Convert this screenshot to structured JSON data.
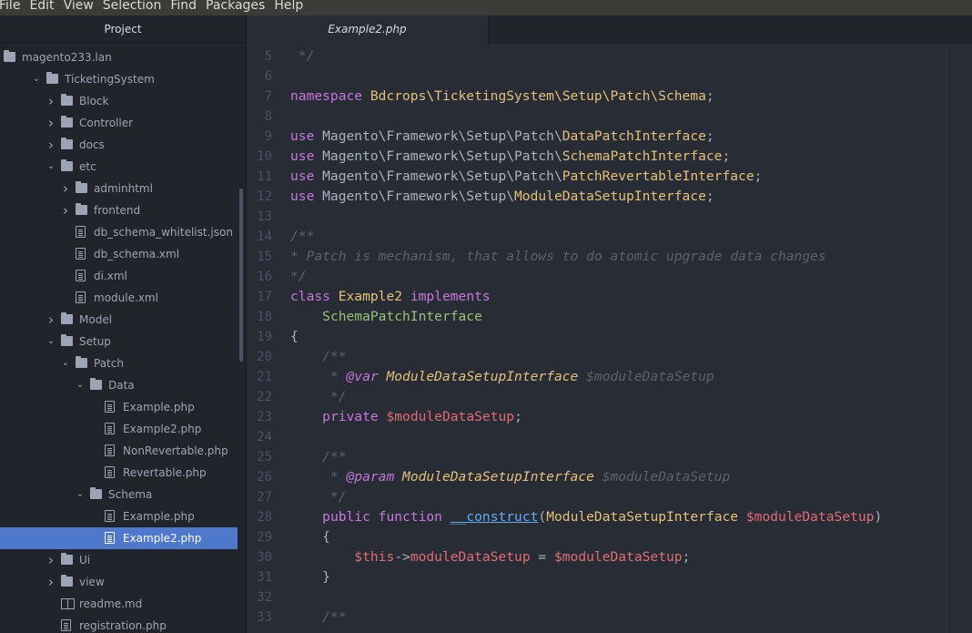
{
  "menu": [
    "File",
    "Edit",
    "View",
    "Selection",
    "Find",
    "Packages",
    "Help"
  ],
  "sidebar": {
    "title": "Project",
    "tree": [
      {
        "label": "magento233.lan",
        "type": "folder",
        "depth": 0,
        "chevron": ""
      },
      {
        "label": "TicketingSystem",
        "type": "folder",
        "depth": 3,
        "chevron": "⌄"
      },
      {
        "label": "Block",
        "type": "folder",
        "depth": 4,
        "chevron": "›"
      },
      {
        "label": "Controller",
        "type": "folder",
        "depth": 4,
        "chevron": "›"
      },
      {
        "label": "docs",
        "type": "folder",
        "depth": 4,
        "chevron": "›"
      },
      {
        "label": "etc",
        "type": "folder",
        "depth": 4,
        "chevron": "⌄"
      },
      {
        "label": "adminhtml",
        "type": "folder",
        "depth": 5,
        "chevron": "›"
      },
      {
        "label": "frontend",
        "type": "folder",
        "depth": 5,
        "chevron": "›"
      },
      {
        "label": "db_schema_whitelist.json",
        "type": "file",
        "depth": 5,
        "chevron": ""
      },
      {
        "label": "db_schema.xml",
        "type": "file",
        "depth": 5,
        "chevron": ""
      },
      {
        "label": "di.xml",
        "type": "file",
        "depth": 5,
        "chevron": ""
      },
      {
        "label": "module.xml",
        "type": "file",
        "depth": 5,
        "chevron": ""
      },
      {
        "label": "Model",
        "type": "folder",
        "depth": 4,
        "chevron": "›"
      },
      {
        "label": "Setup",
        "type": "folder",
        "depth": 4,
        "chevron": "⌄"
      },
      {
        "label": "Patch",
        "type": "folder",
        "depth": 5,
        "chevron": "⌄"
      },
      {
        "label": "Data",
        "type": "folder",
        "depth": 6,
        "chevron": "⌄"
      },
      {
        "label": "Example.php",
        "type": "file",
        "depth": 7,
        "chevron": ""
      },
      {
        "label": "Example2.php",
        "type": "file",
        "depth": 7,
        "chevron": ""
      },
      {
        "label": "NonRevertable.php",
        "type": "file",
        "depth": 7,
        "chevron": ""
      },
      {
        "label": "Revertable.php",
        "type": "file",
        "depth": 7,
        "chevron": ""
      },
      {
        "label": "Schema",
        "type": "folder",
        "depth": 6,
        "chevron": "⌄"
      },
      {
        "label": "Example.php",
        "type": "file",
        "depth": 7,
        "chevron": ""
      },
      {
        "label": "Example2.php",
        "type": "file",
        "depth": 7,
        "chevron": "",
        "selected": true
      },
      {
        "label": "Ui",
        "type": "folder",
        "depth": 4,
        "chevron": "›"
      },
      {
        "label": "view",
        "type": "folder",
        "depth": 4,
        "chevron": "›"
      },
      {
        "label": "readme.md",
        "type": "book",
        "depth": 4,
        "chevron": ""
      },
      {
        "label": "registration.php",
        "type": "file",
        "depth": 4,
        "chevron": ""
      }
    ]
  },
  "tabs": [
    {
      "label": "Example2.php",
      "active": true
    }
  ],
  "editor": {
    "lines": [
      {
        "n": "5",
        "tokens": [
          [
            " */",
            "cm"
          ]
        ]
      },
      {
        "n": "6",
        "tokens": []
      },
      {
        "n": "7",
        "tokens": [
          [
            "namespace",
            "kw"
          ],
          [
            " ",
            "pl"
          ],
          [
            "Bdcrops\\TicketingSystem\\Setup\\Patch\\Schema",
            "tp"
          ],
          [
            ";",
            "pl"
          ]
        ]
      },
      {
        "n": "8",
        "tokens": []
      },
      {
        "n": "9",
        "tokens": [
          [
            "use",
            "kw"
          ],
          [
            " Magento\\Framework\\Setup\\Patch\\",
            "pl"
          ],
          [
            "DataPatchInterface",
            "tp"
          ],
          [
            ";",
            "pl"
          ]
        ]
      },
      {
        "n": "10",
        "tokens": [
          [
            "use",
            "kw"
          ],
          [
            " Magento\\Framework\\Setup\\Patch\\",
            "pl"
          ],
          [
            "SchemaPatchInterface",
            "tp"
          ],
          [
            ";",
            "pl"
          ]
        ]
      },
      {
        "n": "11",
        "tokens": [
          [
            "use",
            "kw"
          ],
          [
            " Magento\\Framework\\Setup\\Patch\\",
            "pl"
          ],
          [
            "PatchRevertableInterface",
            "tp"
          ],
          [
            ";",
            "pl"
          ]
        ]
      },
      {
        "n": "12",
        "tokens": [
          [
            "use",
            "kw"
          ],
          [
            " Magento\\Framework\\Setup\\",
            "pl"
          ],
          [
            "ModuleDataSetupInterface",
            "tp"
          ],
          [
            ";",
            "pl"
          ]
        ]
      },
      {
        "n": "13",
        "tokens": []
      },
      {
        "n": "14",
        "tokens": [
          [
            "/**",
            "cm"
          ]
        ]
      },
      {
        "n": "15",
        "tokens": [
          [
            "* Patch is mechanism, that allows to do atomic upgrade data changes",
            "cm"
          ]
        ]
      },
      {
        "n": "16",
        "tokens": [
          [
            "*/",
            "cm"
          ]
        ]
      },
      {
        "n": "17",
        "tokens": [
          [
            "class",
            "kw"
          ],
          [
            " ",
            "pl"
          ],
          [
            "Example2",
            "tp"
          ],
          [
            " ",
            "pl"
          ],
          [
            "implements",
            "kw"
          ]
        ]
      },
      {
        "n": "18",
        "tokens": [
          [
            "    ",
            "pl"
          ],
          [
            "SchemaPatchInterface",
            "gn"
          ]
        ]
      },
      {
        "n": "19",
        "tokens": [
          [
            "{",
            "pl"
          ]
        ]
      },
      {
        "n": "20",
        "tokens": [
          [
            "    /**",
            "cm"
          ]
        ]
      },
      {
        "n": "21",
        "tokens": [
          [
            "     * ",
            "cm"
          ],
          [
            "@var",
            "dc"
          ],
          [
            " ",
            "cm"
          ],
          [
            "ModuleDataSetupInterface",
            "ct"
          ],
          [
            " $moduleDataSetup",
            "cm"
          ]
        ]
      },
      {
        "n": "22",
        "tokens": [
          [
            "     */",
            "cm"
          ]
        ]
      },
      {
        "n": "23",
        "tokens": [
          [
            "    ",
            "pl"
          ],
          [
            "private",
            "kw"
          ],
          [
            " ",
            "pl"
          ],
          [
            "$moduleDataSetup",
            "vr"
          ],
          [
            ";",
            "pl"
          ]
        ]
      },
      {
        "n": "24",
        "tokens": []
      },
      {
        "n": "25",
        "tokens": [
          [
            "    /**",
            "cm"
          ]
        ]
      },
      {
        "n": "26",
        "tokens": [
          [
            "     * ",
            "cm"
          ],
          [
            "@param",
            "dc"
          ],
          [
            " ",
            "cm"
          ],
          [
            "ModuleDataSetupInterface",
            "ct"
          ],
          [
            " $moduleDataSetup",
            "cm"
          ]
        ]
      },
      {
        "n": "27",
        "tokens": [
          [
            "     */",
            "cm"
          ]
        ]
      },
      {
        "n": "28",
        "tokens": [
          [
            "    ",
            "pl"
          ],
          [
            "public",
            "kw"
          ],
          [
            " ",
            "pl"
          ],
          [
            "function",
            "kw"
          ],
          [
            " ",
            "pl"
          ],
          [
            "__construct",
            "fn"
          ],
          [
            "(",
            "pl"
          ],
          [
            "ModuleDataSetupInterface",
            "tp"
          ],
          [
            " ",
            "pl"
          ],
          [
            "$moduleDataSetup",
            "vr"
          ],
          [
            ")",
            "pl"
          ]
        ]
      },
      {
        "n": "29",
        "tokens": [
          [
            "    {",
            "pl"
          ]
        ]
      },
      {
        "n": "30",
        "tokens": [
          [
            "        ",
            "pl"
          ],
          [
            "$this",
            "vr"
          ],
          [
            "->",
            "pl"
          ],
          [
            "moduleDataSetup",
            "vr"
          ],
          [
            " = ",
            "pl"
          ],
          [
            "$moduleDataSetup",
            "vr"
          ],
          [
            ";",
            "pl"
          ]
        ]
      },
      {
        "n": "31",
        "tokens": [
          [
            "    }",
            "pl"
          ]
        ]
      },
      {
        "n": "32",
        "tokens": []
      },
      {
        "n": "33",
        "tokens": [
          [
            "    /**",
            "cm"
          ]
        ]
      }
    ]
  }
}
